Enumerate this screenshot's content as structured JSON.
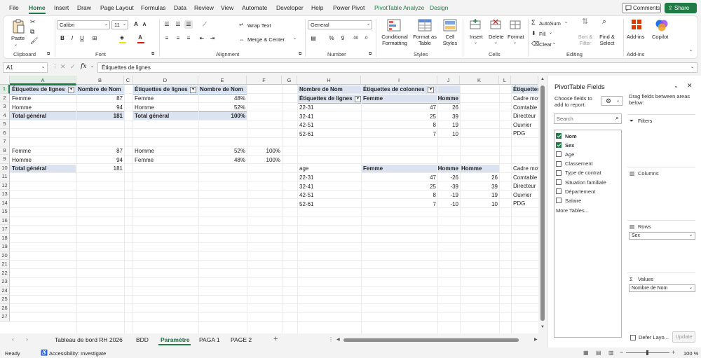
{
  "menu": {
    "tabs": [
      "File",
      "Home",
      "Insert",
      "Draw",
      "Page Layout",
      "Formulas",
      "Data",
      "Review",
      "View",
      "Automate",
      "Developer",
      "Help",
      "Power Pivot",
      "PivotTable Analyze",
      "Design"
    ],
    "comments": "Comments",
    "share": "Share"
  },
  "ribbon": {
    "paste": "Paste",
    "font_name": "Calibri",
    "font_size": "11",
    "wrap_text": "Wrap Text",
    "merge_center": "Merge & Center",
    "number_format": "General",
    "conditional_formatting": "Conditional Formatting",
    "format_as_table": "Format as Table",
    "cell_styles": "Cell Styles",
    "insert": "Insert",
    "delete": "Delete",
    "format": "Format",
    "autosum": "AutoSum",
    "fill": "Fill",
    "clear": "Clear",
    "sort_filter": "Sort & Filter",
    "find_select": "Find & Select",
    "add_ins": "Add-ins",
    "copilot": "Copilot",
    "groups": [
      "Clipboard",
      "Font",
      "Alignment",
      "Number",
      "Styles",
      "Cells",
      "Editing",
      "Add-ins"
    ]
  },
  "formula_bar": {
    "name_box": "A1",
    "fx": "fx",
    "content": "Étiquettes de lignes"
  },
  "grid": {
    "columns": [
      "A",
      "B",
      "C",
      "D",
      "E",
      "F",
      "G",
      "H",
      "I",
      "J",
      "K",
      "L"
    ],
    "rows": [
      "1",
      "2",
      "3",
      "4",
      "5",
      "6",
      "7",
      "8",
      "9",
      "10",
      "11",
      "12",
      "13",
      "14",
      "15",
      "16",
      "17",
      "18",
      "19",
      "20",
      "21",
      "22",
      "23",
      "24",
      "25",
      "26",
      "27"
    ],
    "t1": {
      "h1": "Étiquettes de lignes",
      "h2": "Nombre de Nom",
      "r1": "Femme",
      "v1": "87",
      "r2": "Homme",
      "v2": "94",
      "tot": "Total général",
      "vt": "181"
    },
    "t2": {
      "h1": "Étiquettes de lignes",
      "h2": "Nombre de Nom",
      "r1": "Femme",
      "v1": "48%",
      "r2": "Homme",
      "v2": "52%",
      "tot": "Total général",
      "vt": "100%"
    },
    "t3": {
      "h0": "Nombre de Nom",
      "hc": "Étiquettes de colonnes",
      "h1": "Étiquettes de lignes",
      "c1": "Femme",
      "c2": "Homme",
      "rows": [
        {
          "k": "22-31",
          "f": "47",
          "h": "26"
        },
        {
          "k": "32-41",
          "f": "25",
          "h": "39"
        },
        {
          "k": "42-51",
          "f": "8",
          "h": "19"
        },
        {
          "k": "52-61",
          "f": "7",
          "h": "10"
        }
      ]
    },
    "t4": {
      "h": "Étiquettes",
      "rows": [
        "Cadre moyen",
        "Comtable",
        "Directeur",
        "Ouvrier",
        "PDG"
      ]
    },
    "b1": {
      "r1": "Femme",
      "v1": "87",
      "r2": "Homme",
      "v2": "94",
      "tot": "Total général",
      "vt": "181"
    },
    "b2": {
      "r1": "Homme",
      "v1": "52%",
      "p1": "100%",
      "r2": "Femme",
      "v2": "48%",
      "p2": "100%"
    },
    "b3": {
      "h0": "age",
      "c1": "Femme",
      "c2": "Homme",
      "c3": "Homme",
      "rows": [
        {
          "k": "22-31",
          "f": "47",
          "h": "-26",
          "h2": "26"
        },
        {
          "k": "32-41",
          "f": "25",
          "h": "-39",
          "h2": "39"
        },
        {
          "k": "42-51",
          "f": "8",
          "h": "-19",
          "h2": "19"
        },
        {
          "k": "52-61",
          "f": "7",
          "h": "-10",
          "h2": "10"
        }
      ]
    },
    "b4": {
      "rows": [
        "Cadre moyen",
        "Comtable",
        "Directeur",
        "Ouvrier",
        "PDG"
      ]
    }
  },
  "sheet_tabs": [
    "Tableau de bord RH 2026",
    "BDD",
    "Paramètre",
    "PAGA 1",
    "PAGE 2"
  ],
  "active_tab": "Paramètre",
  "status": {
    "ready": "Ready",
    "accessibility": "Accessibility: Investigate",
    "zoom": "100 %"
  },
  "pivot": {
    "title": "PivotTable Fields",
    "choose": "Choose fields to add to report:",
    "drag": "Drag fields between areas below:",
    "search_placeholder": "Search",
    "fields": [
      {
        "name": "Nom",
        "checked": true
      },
      {
        "name": "Sex",
        "checked": true
      },
      {
        "name": "Age",
        "checked": false
      },
      {
        "name": "Classement",
        "checked": false
      },
      {
        "name": "Type de contrat",
        "checked": false
      },
      {
        "name": "Situation familiale",
        "checked": false
      },
      {
        "name": "Département",
        "checked": false
      },
      {
        "name": "Salaire",
        "checked": false
      }
    ],
    "more_tables": "More Tables...",
    "areas": {
      "filters": "Filters",
      "columns": "Columns",
      "rows": "Rows",
      "values": "Values"
    },
    "rows_chip": "Sex",
    "values_chip": "Nombre de Nom",
    "defer": "Defer Layo...",
    "update": "Update"
  },
  "colors": {
    "accent": "#1f7a45",
    "pivot_header": "#dce3f0"
  }
}
